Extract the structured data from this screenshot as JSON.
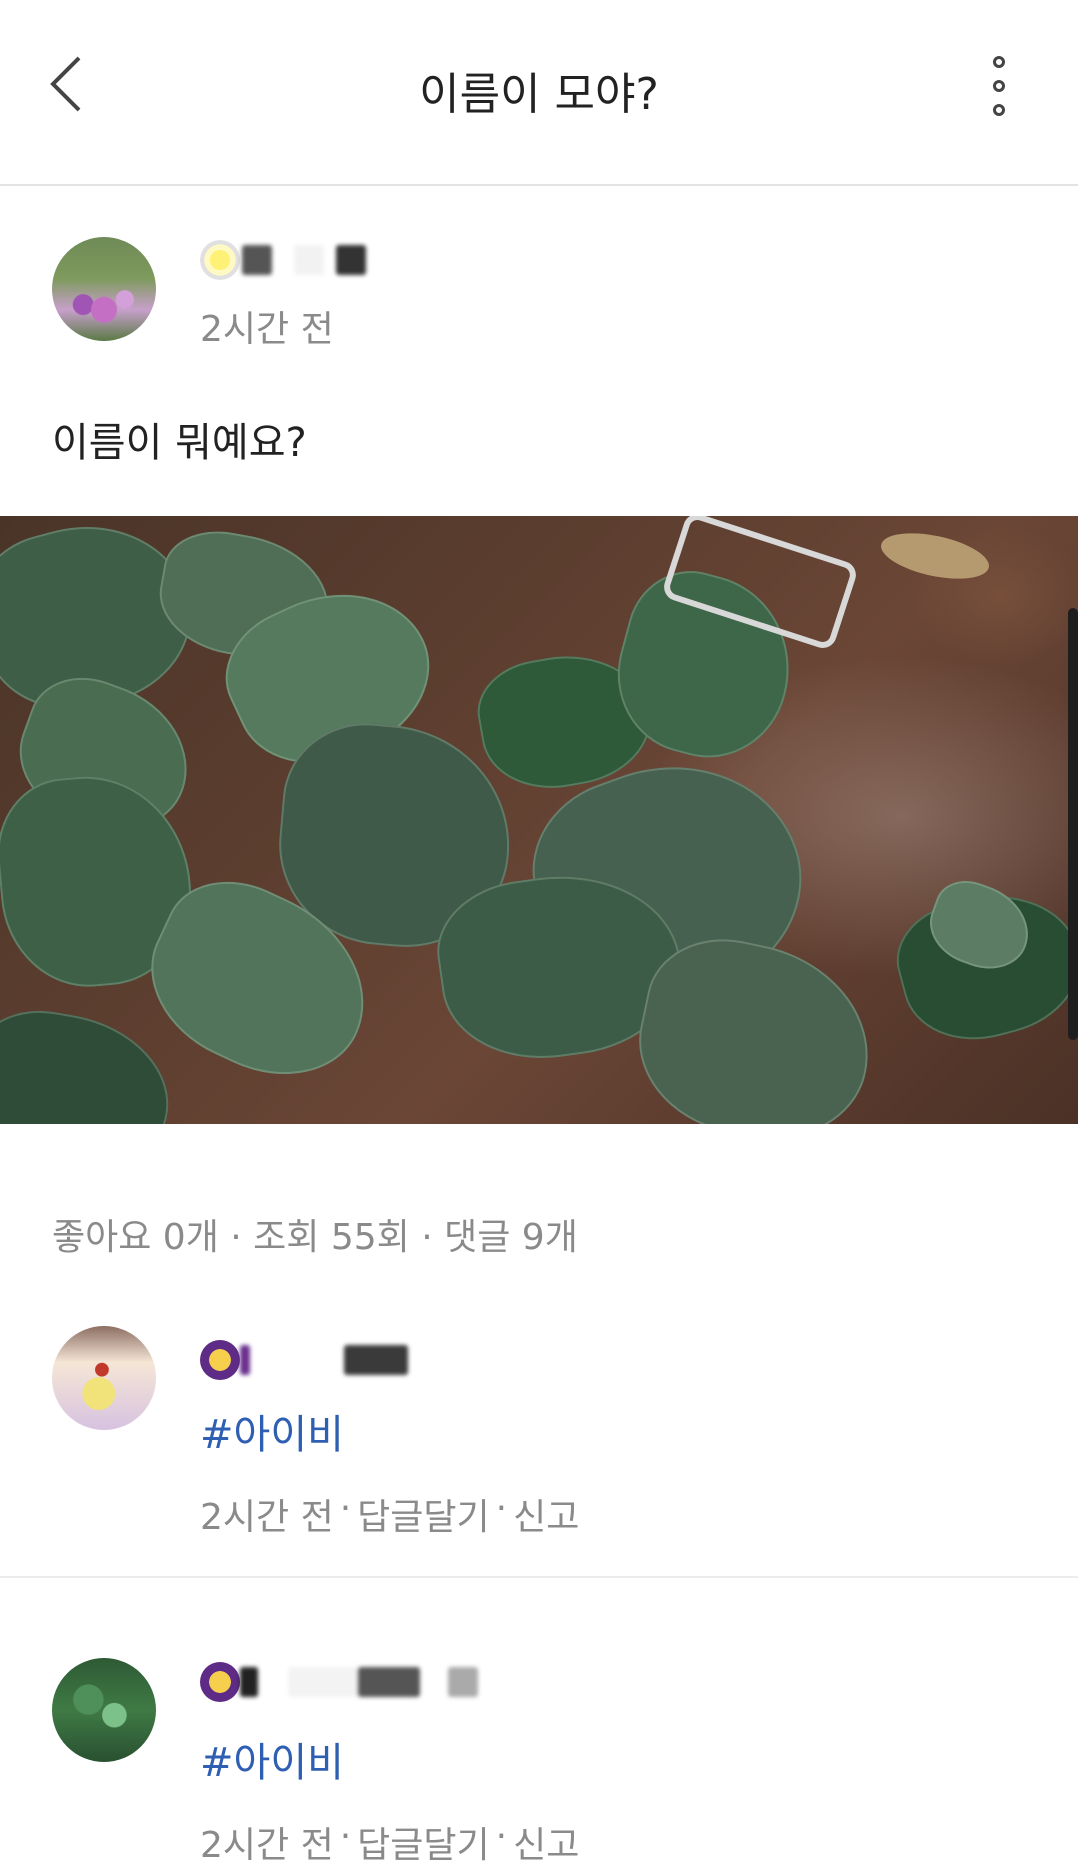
{
  "header": {
    "title": "이름이 모야?",
    "back_icon": "chevron-left-icon",
    "more_icon": "vertical-dots-icon"
  },
  "post": {
    "author_badge_icon": "sun-flower-icon",
    "time": "2시간 전",
    "text": "이름이 뭐예요?",
    "image_icon": "ivy-photo",
    "stats": "좋아요 0개 · 조회 55회 · 댓글 9개"
  },
  "comments": [
    {
      "badge_icon": "god-badge-icon",
      "tag": "#아이비",
      "time": "2시간 전",
      "reply": "답글달기",
      "report": "신고",
      "sep": "·"
    },
    {
      "badge_icon": "god-badge-icon",
      "tag": "#아이비",
      "time": "2시간 전",
      "reply": "답글달기",
      "report": "신고",
      "sep": "·"
    }
  ],
  "colors": {
    "tag": "#2f5fb3",
    "meta": "#8a8a8a",
    "divider": "#ececec"
  }
}
